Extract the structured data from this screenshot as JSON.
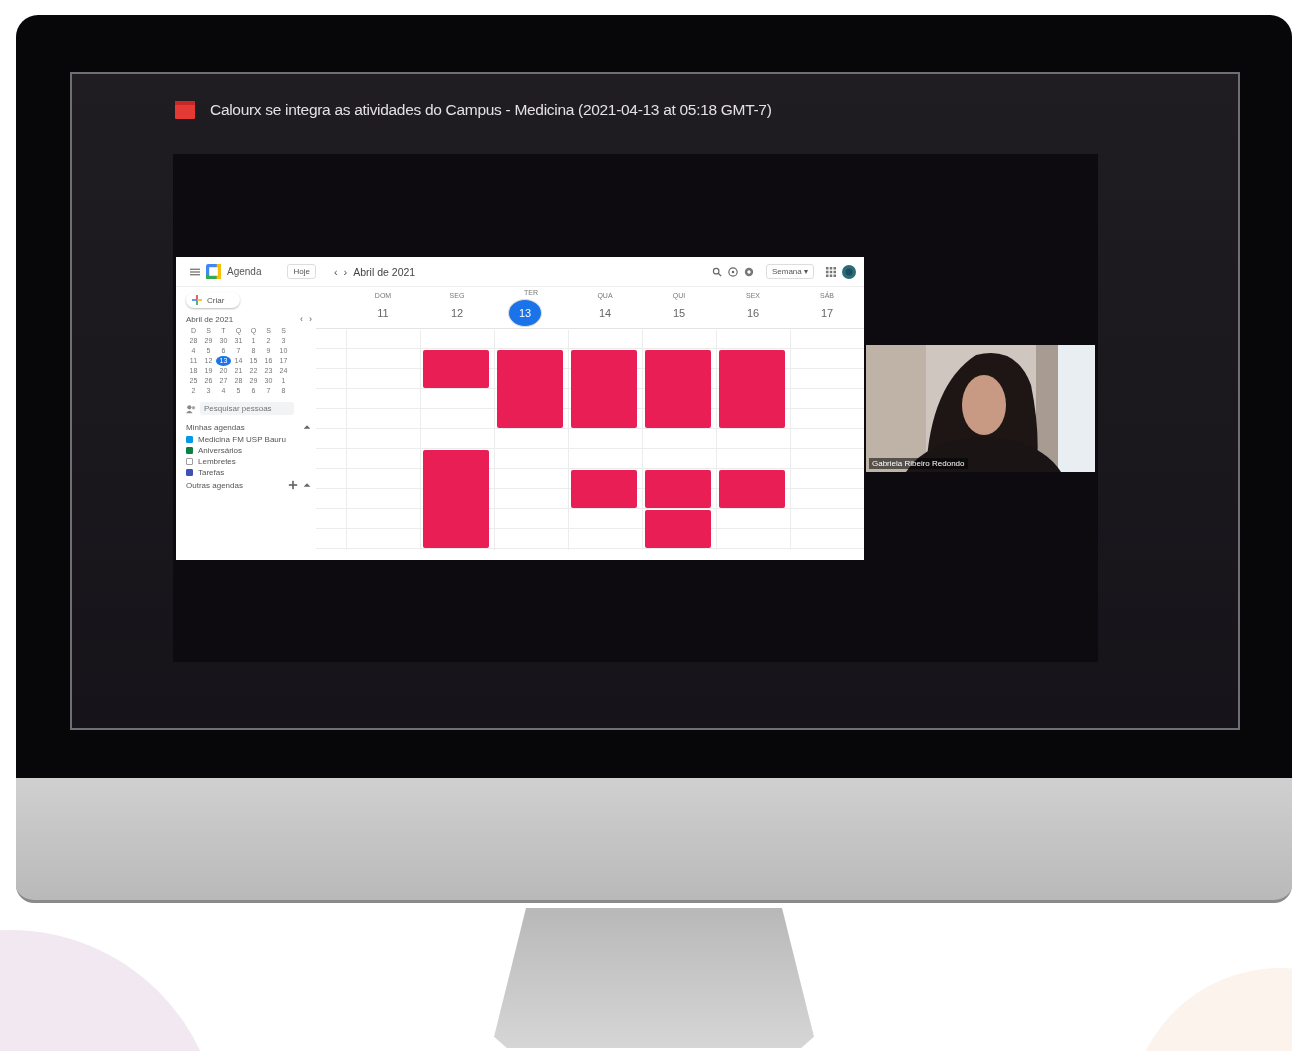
{
  "meeting": {
    "title": "Calourx se integra as atividades do Campus - Medicina (2021-04-13 at 05:18 GMT-7)"
  },
  "calendar": {
    "app_name": "Agenda",
    "today_button": "Hoje",
    "prev": "‹",
    "next": "›",
    "period": "Abril de 2021",
    "view_menu": "Semana ▾",
    "create_button": "Criar",
    "mini_month": {
      "title": "Abril de 2021",
      "prev": "‹",
      "next": "›",
      "weekdays": [
        "D",
        "S",
        "T",
        "Q",
        "Q",
        "S",
        "S"
      ],
      "weeks": [
        [
          {
            "day": "28",
            "selected": false
          },
          {
            "day": "29",
            "selected": false
          },
          {
            "day": "30",
            "selected": false
          },
          {
            "day": "31",
            "selected": false
          },
          {
            "day": "1",
            "selected": false
          },
          {
            "day": "2",
            "selected": false
          },
          {
            "day": "3",
            "selected": false
          }
        ],
        [
          {
            "day": "4",
            "selected": false
          },
          {
            "day": "5",
            "selected": false
          },
          {
            "day": "6",
            "selected": false
          },
          {
            "day": "7",
            "selected": false
          },
          {
            "day": "8",
            "selected": false
          },
          {
            "day": "9",
            "selected": false
          },
          {
            "day": "10",
            "selected": false
          }
        ],
        [
          {
            "day": "11",
            "selected": false
          },
          {
            "day": "12",
            "selected": false
          },
          {
            "day": "13",
            "selected": true
          },
          {
            "day": "14",
            "selected": false
          },
          {
            "day": "15",
            "selected": false
          },
          {
            "day": "16",
            "selected": false
          },
          {
            "day": "17",
            "selected": false
          }
        ],
        [
          {
            "day": "18",
            "selected": false
          },
          {
            "day": "19",
            "selected": false
          },
          {
            "day": "20",
            "selected": false
          },
          {
            "day": "21",
            "selected": false
          },
          {
            "day": "22",
            "selected": false
          },
          {
            "day": "23",
            "selected": false
          },
          {
            "day": "24",
            "selected": false
          }
        ],
        [
          {
            "day": "25",
            "selected": false
          },
          {
            "day": "26",
            "selected": false
          },
          {
            "day": "27",
            "selected": false
          },
          {
            "day": "28",
            "selected": false
          },
          {
            "day": "29",
            "selected": false
          },
          {
            "day": "30",
            "selected": false
          },
          {
            "day": "1",
            "selected": false
          }
        ],
        [
          {
            "day": "2",
            "selected": false
          },
          {
            "day": "3",
            "selected": false
          },
          {
            "day": "4",
            "selected": false
          },
          {
            "day": "5",
            "selected": false
          },
          {
            "day": "6",
            "selected": false
          },
          {
            "day": "7",
            "selected": false
          },
          {
            "day": "8",
            "selected": false
          }
        ]
      ]
    },
    "people_search": {
      "placeholder": "Pesquisar pessoas"
    },
    "my_calendars": {
      "title": "Minhas agendas",
      "items": [
        {
          "label": "Medicina FM USP Bauru",
          "checked": true,
          "color": "#039be5"
        },
        {
          "label": "Aniversários",
          "checked": true,
          "color": "#0b8043"
        },
        {
          "label": "Lembretes",
          "checked": false,
          "color": "#9e9e9e"
        },
        {
          "label": "Tarefas",
          "checked": true,
          "color": "#3f51b5"
        }
      ]
    },
    "other_calendars": {
      "title": "Outras agendas"
    },
    "days": [
      {
        "weekday": "DOM",
        "date": "11",
        "selected": false
      },
      {
        "weekday": "SEG",
        "date": "12",
        "selected": false,
        "blocks": [
          {
            "kind": "gap"
          },
          {
            "kind": "short_event"
          },
          {
            "kind": "gap"
          },
          {
            "kind": "gap"
          },
          {
            "kind": "gap"
          },
          {
            "kind": "tall_event"
          }
        ]
      },
      {
        "weekday": "TER",
        "date": "13",
        "selected": true,
        "blocks": [
          {
            "kind": "gap"
          },
          {
            "kind": "long_event"
          }
        ]
      },
      {
        "weekday": "QUA",
        "date": "14",
        "selected": false,
        "blocks": [
          {
            "kind": "gap"
          },
          {
            "kind": "long_event"
          },
          {
            "kind": "gap"
          },
          {
            "kind": "gap"
          },
          {
            "kind": "short_event"
          }
        ]
      },
      {
        "weekday": "QUI",
        "date": "15",
        "selected": false,
        "blocks": [
          {
            "kind": "gap"
          },
          {
            "kind": "long_event"
          },
          {
            "kind": "gap"
          },
          {
            "kind": "gap"
          },
          {
            "kind": "short_event"
          },
          {
            "kind": "short_event"
          }
        ]
      },
      {
        "weekday": "SEX",
        "date": "16",
        "selected": false,
        "blocks": [
          {
            "kind": "gap"
          },
          {
            "kind": "long_event"
          },
          {
            "kind": "gap"
          },
          {
            "kind": "gap"
          },
          {
            "kind": "short_event"
          }
        ]
      },
      {
        "weekday": "SÁB",
        "date": "17",
        "selected": false
      }
    ]
  },
  "participant": {
    "name": "Gabriela Ribeiro Redondo"
  }
}
